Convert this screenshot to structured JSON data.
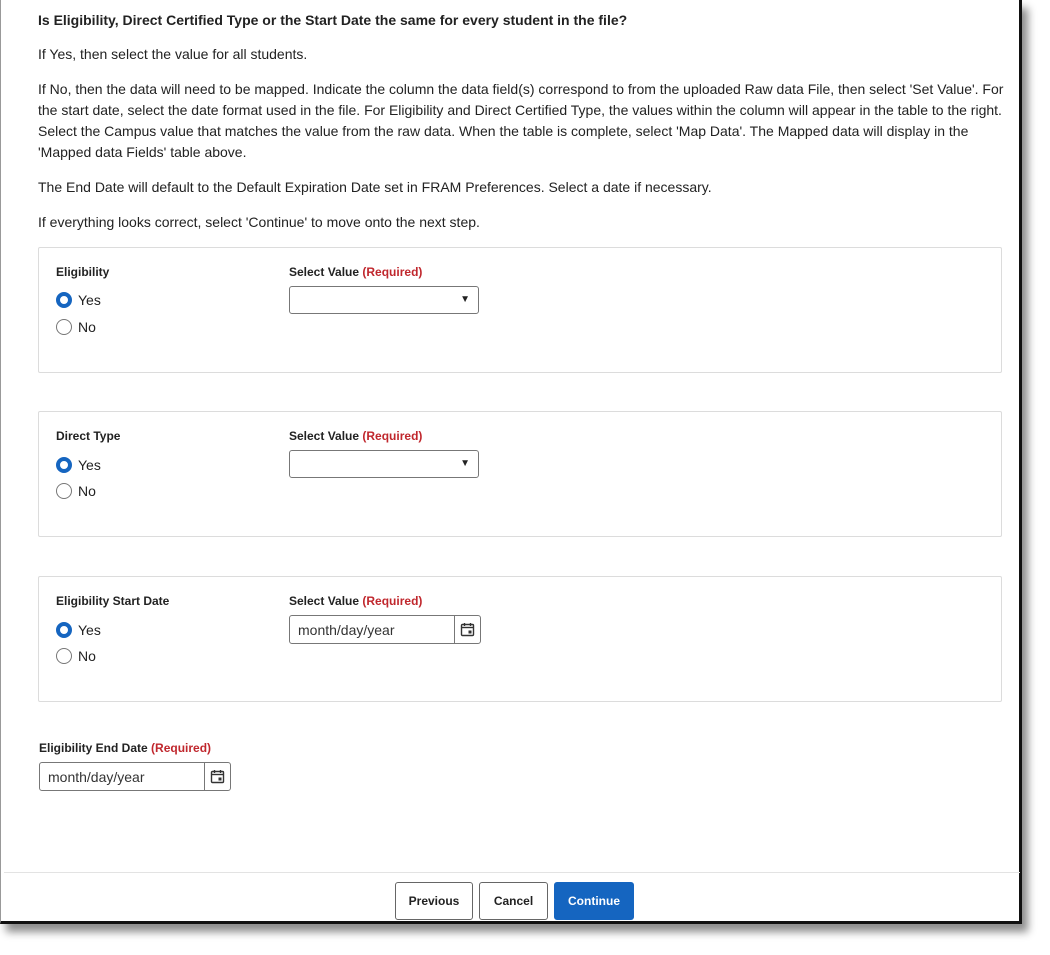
{
  "intro": {
    "heading": "Is Eligibility, Direct Certified Type or the Start Date the same for every student in the file?",
    "p1": "If Yes, then select the value for all students.",
    "p2": "If No, then the data will need to be mapped. Indicate the column the data field(s) correspond to from the uploaded Raw data File, then select 'Set Value'. For the start date, select the date format used in the file. For Eligibility and Direct Certified Type, the values within the column will appear in the table to the right. Select the Campus value that matches the value from the raw data. When the table is complete, select 'Map Data'. The Mapped data will display in the 'Mapped data Fields' table above.",
    "p3": "The End Date will default to the Default Expiration Date set in FRAM Preferences. Select a date if necessary.",
    "p4": "If everything looks correct, select 'Continue' to move onto the next step."
  },
  "common": {
    "select_value_label": "Select Value",
    "required": "(Required)",
    "yes": "Yes",
    "no": "No",
    "date_placeholder": "month/day/year"
  },
  "panels": [
    {
      "title": "Eligibility",
      "selected": "Yes",
      "input_type": "select",
      "value": ""
    },
    {
      "title": "Direct Type",
      "selected": "Yes",
      "input_type": "select",
      "value": ""
    },
    {
      "title": "Eligibility Start Date",
      "selected": "Yes",
      "input_type": "date",
      "value": "month/day/year"
    }
  ],
  "end_date": {
    "label": "Eligibility End Date",
    "required": "(Required)",
    "value": "month/day/year"
  },
  "footer": {
    "previous": "Previous",
    "cancel": "Cancel",
    "continue": "Continue"
  },
  "colors": {
    "accent": "#1565c0",
    "required": "#c0272d"
  }
}
